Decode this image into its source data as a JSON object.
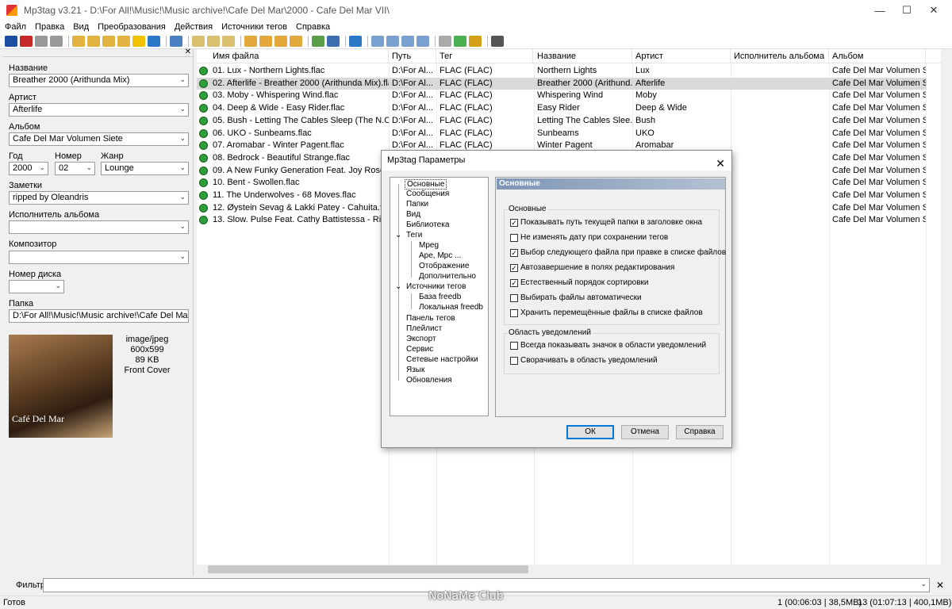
{
  "window": {
    "title": "Mp3tag v3.21  -  D:\\For All!\\Music!\\Music archive!\\Cafe Del Mar\\2000 - Cafe Del Mar VII\\"
  },
  "menu": [
    "Файл",
    "Правка",
    "Вид",
    "Преобразования",
    "Действия",
    "Источники тегов",
    "Справка"
  ],
  "left": {
    "title_label": "Название",
    "title_value": "Breather 2000 (Arithunda Mix)",
    "artist_label": "Артист",
    "artist_value": "Afterlife",
    "album_label": "Альбом",
    "album_value": "Cafe Del Mar Volumen Siete",
    "year_label": "Год",
    "year_value": "2000",
    "track_label": "Номер",
    "track_value": "02",
    "genre_label": "Жанр",
    "genre_value": "Lounge",
    "comment_label": "Заметки",
    "comment_value": "ripped by Oleandris",
    "album_artist_label": "Исполнитель альбома",
    "composer_label": "Композитор",
    "disc_label": "Номер диска",
    "folder_label": "Папка",
    "folder_value": "D:\\For All!\\Music!\\Music archive!\\Cafe Del Mar\\",
    "cover_text": "Café Del Mar",
    "cover_mime": "image/jpeg",
    "cover_dim": "600x599",
    "cover_size": "89 KB",
    "cover_type": "Front Cover"
  },
  "columns": [
    "Имя файла",
    "Путь",
    "Тег",
    "Название",
    "Артист",
    "Исполнитель альбома",
    "Альбом"
  ],
  "rows": [
    {
      "file": "01. Lux - Northern Lights.flac",
      "path": "D:\\For Al...",
      "tag": "FLAC (FLAC)",
      "title": "Northern Lights",
      "artist": "Lux",
      "aa": "",
      "album": "Cafe Del Mar Volumen S..."
    },
    {
      "file": "02. Afterlife - Breather 2000 (Arithunda Mix).flac",
      "path": "D:\\For Al...",
      "tag": "FLAC (FLAC)",
      "title": "Breather 2000 (Arithund...",
      "artist": "Afterlife",
      "aa": "",
      "album": "Cafe Del Mar Volumen S..."
    },
    {
      "file": "03. Moby - Whispering Wind.flac",
      "path": "D:\\For Al...",
      "tag": "FLAC (FLAC)",
      "title": "Whispering Wind",
      "artist": "Moby",
      "aa": "",
      "album": "Cafe Del Mar Volumen S..."
    },
    {
      "file": "04. Deep & Wide - Easy Rider.flac",
      "path": "D:\\For Al...",
      "tag": "FLAC (FLAC)",
      "title": "Easy Rider",
      "artist": "Deep & Wide",
      "aa": "",
      "album": "Cafe Del Mar Volumen S..."
    },
    {
      "file": "05. Bush - Letting The Cables Sleep (The N.O.W...",
      "path": "D:\\For Al...",
      "tag": "FLAC (FLAC)",
      "title": "Letting The Cables Slee...",
      "artist": "Bush",
      "aa": "",
      "album": "Cafe Del Mar Volumen S..."
    },
    {
      "file": "06. UKO - Sunbeams.flac",
      "path": "D:\\For Al...",
      "tag": "FLAC (FLAC)",
      "title": "Sunbeams",
      "artist": "UKO",
      "aa": "",
      "album": "Cafe Del Mar Volumen S..."
    },
    {
      "file": "07. Aromabar - Winter Pagent.flac",
      "path": "D:\\For Al...",
      "tag": "FLAC (FLAC)",
      "title": "Winter Pagent",
      "artist": "Aromabar",
      "aa": "",
      "album": "Cafe Del Mar Volumen S..."
    },
    {
      "file": "08. Bedrock - Beautiful Strange.flac",
      "path": "",
      "tag": "",
      "title": "",
      "artist": "",
      "aa": "",
      "album": "Cafe Del Mar Volumen S..."
    },
    {
      "file": "09. A New Funky Generation Feat. Joy Rose - O...",
      "path": "",
      "tag": "",
      "title": "",
      "artist": "",
      "aa": "",
      "album": "Cafe Del Mar Volumen S..."
    },
    {
      "file": "10. Bent - Swollen.flac",
      "path": "",
      "tag": "",
      "title": "",
      "artist": "",
      "aa": "",
      "album": "Cafe Del Mar Volumen S..."
    },
    {
      "file": "11. The Underwolves - 68 Moves.flac",
      "path": "",
      "tag": "",
      "title": "",
      "artist": "",
      "aa": "",
      "album": "Cafe Del Mar Volumen S..."
    },
    {
      "file": "12. Øystein Sevag & Lakki Patey - Cahuita.flac",
      "path": "",
      "tag": "",
      "title": "",
      "artist": "",
      "aa": "",
      "album": "Cafe Del Mar Volumen S..."
    },
    {
      "file": "13. Slow. Pulse Feat. Cathy Battistessa - Riva.flac",
      "path": "",
      "tag": "",
      "title": "",
      "artist": "",
      "aa": "",
      "album": "Cafe Del Mar Volumen S..."
    }
  ],
  "filter_label": "Фильтр",
  "status": {
    "ready": "Готов",
    "sel": "1 (00:06:03 | 38,5MB)",
    "total": "13 (01:07:13 | 400,1MB)"
  },
  "dialog": {
    "title": "Mp3tag Параметры",
    "tree": [
      "Основные",
      "Сообщения",
      "Папки",
      "Вид",
      "Библиотека",
      "Теги",
      "Mpeg",
      "Ape, Mpc ...",
      "Отображение",
      "Дополнительно",
      "Источники тегов",
      "База freedb",
      "Локальная freedb",
      "Панель тегов",
      "Плейлист",
      "Экспорт",
      "Сервис",
      "Сетевые настройки",
      "Язык",
      "Обновления"
    ],
    "header": "Основные",
    "group1": "Основные",
    "opts1": [
      {
        "label": "Показывать путь текущей папки в заголовке окна",
        "checked": true
      },
      {
        "label": "Не изменять дату при сохранении тегов",
        "checked": false
      },
      {
        "label": "Выбор следующего файла при правке в списке файлов",
        "checked": true
      },
      {
        "label": "Автозавершение в полях редактирования",
        "checked": true
      },
      {
        "label": "Естественный порядок сортировки",
        "checked": true
      },
      {
        "label": "Выбирать файлы автоматически",
        "checked": false
      },
      {
        "label": "Хранить перемещённые файлы в списке файлов",
        "checked": false
      }
    ],
    "group2": "Область уведомлений",
    "opts2": [
      {
        "label": "Всегда показывать значок в области уведомлений",
        "checked": false
      },
      {
        "label": "Сворачивать в область уведомлений",
        "checked": false
      }
    ],
    "ok": "ОК",
    "cancel": "Отмена",
    "help": "Справка"
  },
  "watermark": "NoNaMe Club"
}
